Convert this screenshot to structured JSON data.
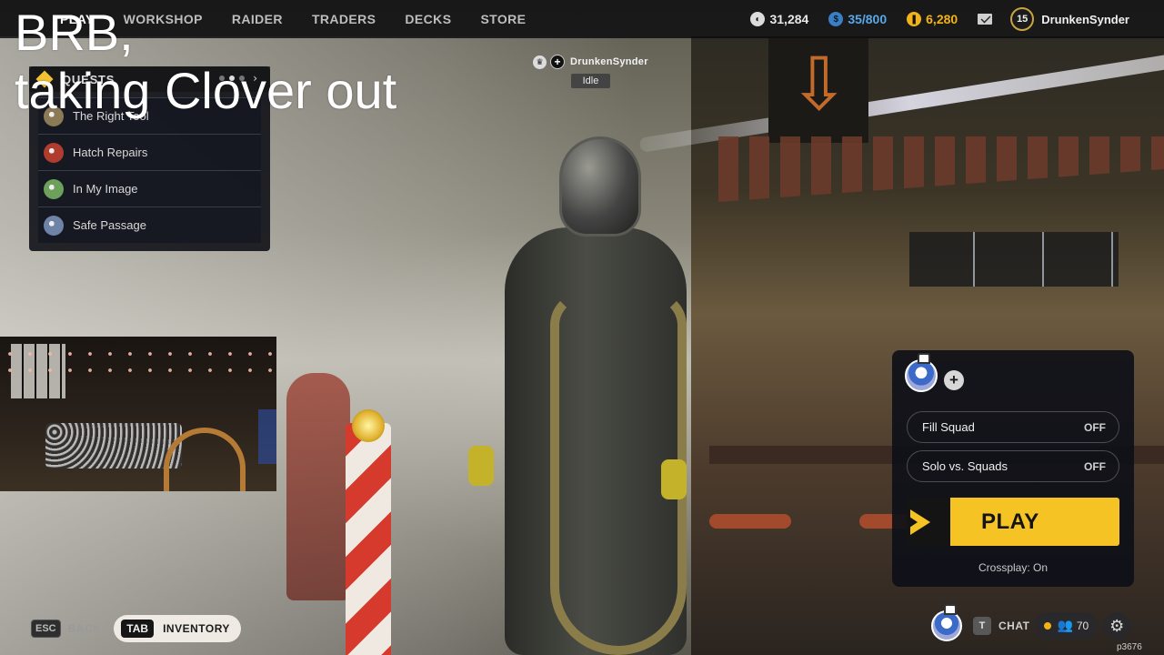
{
  "overlay": {
    "text": "BRB,\ntaking Clover out"
  },
  "nav": {
    "items": [
      "PLAY",
      "WORKSHOP",
      "RAIDER",
      "TRADERS",
      "DECKS",
      "STORE"
    ],
    "active": "PLAY"
  },
  "currencies": {
    "coins": "31,284",
    "tokens": "35/800",
    "credits": "6,280"
  },
  "profile": {
    "level": "15",
    "username": "DrunkenSynder"
  },
  "quests": {
    "title": "QUESTS",
    "items": [
      {
        "name": "The Right Tool",
        "color": "#8a7a55"
      },
      {
        "name": "Hatch Repairs",
        "color": "#b03c2e"
      },
      {
        "name": "In My Image",
        "color": "#6da05a"
      },
      {
        "name": "Safe Passage",
        "color": "#6f83a6"
      }
    ]
  },
  "player_tag": {
    "name": "DrunkenSynder",
    "status": "Idle"
  },
  "squad": {
    "options": [
      {
        "label": "Fill Squad",
        "value": "OFF"
      },
      {
        "label": "Solo vs. Squads",
        "value": "OFF"
      }
    ],
    "play_label": "PLAY",
    "crossplay": "Crossplay: On"
  },
  "bottom": {
    "esc_key": "ESC",
    "back_label": "BACK",
    "tab_key": "TAB",
    "inventory_label": "INVENTORY",
    "chat_key": "T",
    "chat_label": "CHAT",
    "friends_online": "70",
    "build": "p3676"
  },
  "colors": {
    "accent": "#f6c325",
    "panel": "#0e1018",
    "tokens": "#5aa7ea",
    "credits": "#f2b319"
  }
}
